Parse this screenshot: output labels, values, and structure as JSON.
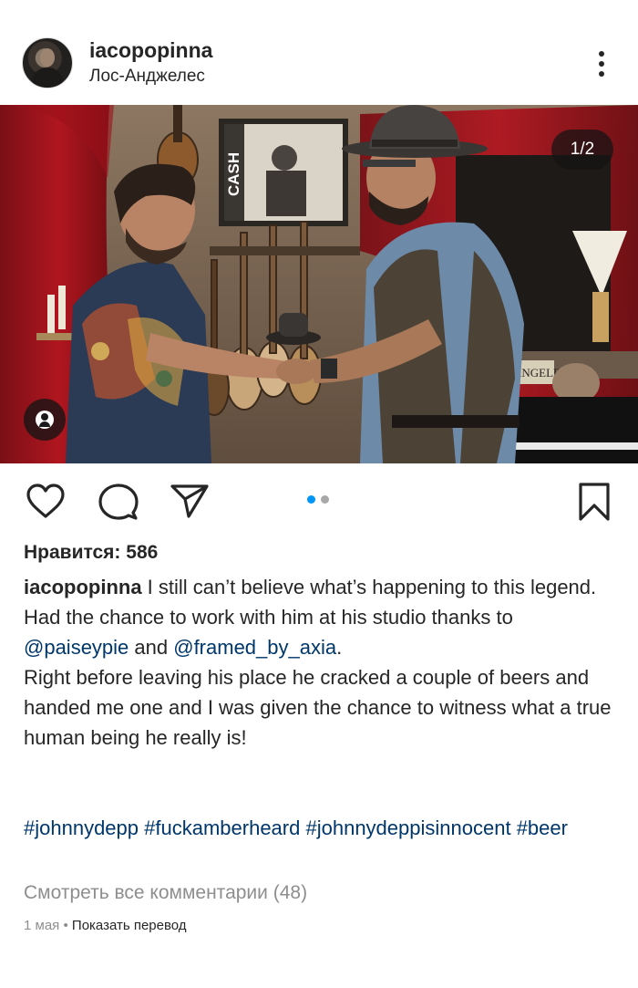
{
  "post": {
    "username": "iacopopinna",
    "location": "Лос-Анджелес",
    "photo_counter": "1/2",
    "likes": "Нравится: 586",
    "caption": {
      "user": "iacopopinna",
      "line1": " I still can’t believe what’s happening to this legend.",
      "line2": "Had the chance to work with him at his studio thanks to ",
      "mention1": "@paiseypie",
      "and": " and ",
      "mention2": "@framed_by_axia",
      "line2_end": ".",
      "line3": "Right before leaving his place he cracked a couple of beers and handed me one and I was given the chance to witness what a true human being he really is!"
    },
    "hashtags": [
      "#johnnydepp",
      "#fuckamberheard",
      "#johnnydeppisinnocent",
      "#beer"
    ],
    "view_comments": "Смотреть все комментарии (48)",
    "date": "1 мая",
    "separator": "•",
    "translate": "Показать перевод",
    "photo_text": {
      "poster": "CASH",
      "sign": "ANGELES"
    }
  },
  "carousel": {
    "total": 2,
    "active": 1
  },
  "colors": {
    "text": "#262626",
    "link": "#00376b",
    "secondary": "#8e8e8e",
    "active_dot": "#0095f6",
    "inactive_dot": "#a8a8a8"
  },
  "icons": {
    "more": "more-vertical-icon",
    "tag": "user-tag-icon",
    "like": "heart-icon",
    "comment": "comment-icon",
    "share": "share-icon",
    "save": "bookmark-icon"
  }
}
